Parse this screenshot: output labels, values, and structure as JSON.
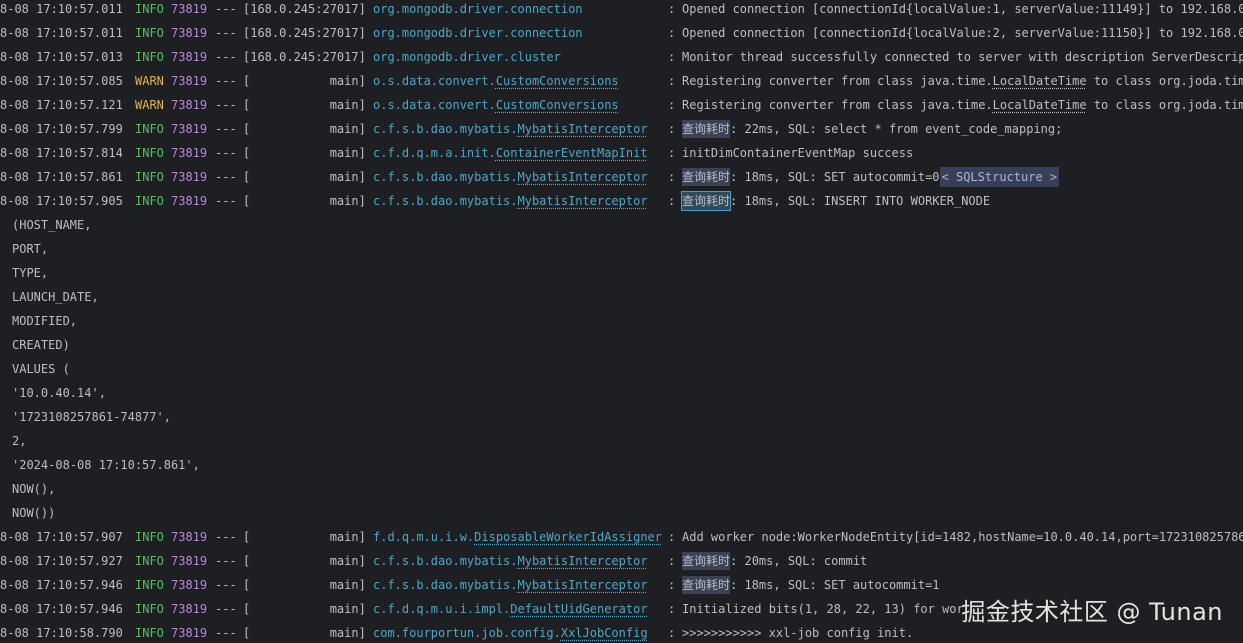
{
  "lines": [
    {
      "ts": "8-08 17:10:57.011",
      "level": "INFO",
      "pid": "73819",
      "dashes": "---",
      "thread": "[168.0.245:27017]",
      "logger_pre": "org.mongodb.driver.connection",
      "logger_cls": "",
      "colon": ":",
      "msg_hl": "",
      "msg": "Opened connection [connectionId{localValue:1, serverValue:11149}] to 192.168.0"
    },
    {
      "ts": "8-08 17:10:57.011",
      "level": "INFO",
      "pid": "73819",
      "dashes": "---",
      "thread": "[168.0.245:27017]",
      "logger_pre": "org.mongodb.driver.connection",
      "logger_cls": "",
      "colon": ":",
      "msg_hl": "",
      "msg": "Opened connection [connectionId{localValue:2, serverValue:11150}] to 192.168.0"
    },
    {
      "ts": "8-08 17:10:57.013",
      "level": "INFO",
      "pid": "73819",
      "dashes": "---",
      "thread": "[168.0.245:27017]",
      "logger_pre": "org.mongodb.driver.cluster",
      "logger_cls": "",
      "colon": ":",
      "msg_hl": "",
      "msg": "Monitor thread successfully connected to server with description ServerDescrip"
    },
    {
      "ts": "8-08 17:10:57.085",
      "level": "WARN",
      "pid": "73819",
      "dashes": "---",
      "thread": "[           main]",
      "logger_pre": "o.s.data.convert.",
      "logger_cls": "CustomConversions",
      "colon": ":",
      "msg_hl": "",
      "msg_pre": "Registering converter from class java.time.",
      "msg_ul": "LocalDateTime",
      "msg": " to class org.joda.tim"
    },
    {
      "ts": "8-08 17:10:57.121",
      "level": "WARN",
      "pid": "73819",
      "dashes": "---",
      "thread": "[           main]",
      "logger_pre": "o.s.data.convert.",
      "logger_cls": "CustomConversions",
      "colon": ":",
      "msg_hl": "",
      "msg_pre": "Registering converter from class java.time.",
      "msg_ul": "LocalDateTime",
      "msg": " to class org.joda.tim"
    },
    {
      "ts": "8-08 17:10:57.799",
      "level": "INFO",
      "pid": "73819",
      "dashes": "---",
      "thread": "[           main]",
      "logger_pre": "c.f.s.b.dao.mybatis.",
      "logger_cls": "MybatisInterceptor",
      "colon": ":",
      "msg_hl": "查询耗时",
      "msg": ": 22ms, SQL: select * from event_code_mapping;"
    },
    {
      "ts": "8-08 17:10:57.814",
      "level": "INFO",
      "pid": "73819",
      "dashes": "---",
      "thread": "[           main]",
      "logger_pre": "c.f.d.q.m.a.init.",
      "logger_cls": "ContainerEventMapInit",
      "colon": ":",
      "msg_hl": "",
      "msg": "initDimContainerEventMap success"
    },
    {
      "ts": "8-08 17:10:57.861",
      "level": "INFO",
      "pid": "73819",
      "dashes": "---",
      "thread": "[           main]",
      "logger_pre": "c.f.s.b.dao.mybatis.",
      "logger_cls": "MybatisInterceptor",
      "colon": ":",
      "msg_hl": "查询耗时",
      "msg": ": 18ms, SQL: SET autocommit=0",
      "msg_tag": "< SQLStructure >"
    },
    {
      "ts": "8-08 17:10:57.905",
      "level": "INFO",
      "pid": "73819",
      "dashes": "---",
      "thread": "[           main]",
      "logger_pre": "c.f.s.b.dao.mybatis.",
      "logger_cls": "MybatisInterceptor",
      "colon": ":",
      "msg_hl_box": "查询耗时",
      "msg": ": 18ms, SQL: INSERT INTO WORKER_NODE"
    },
    {
      "cont": "(HOST_NAME,"
    },
    {
      "cont": "PORT,"
    },
    {
      "cont": "TYPE,"
    },
    {
      "cont": "LAUNCH_DATE,"
    },
    {
      "cont": "MODIFIED,"
    },
    {
      "cont": "CREATED)"
    },
    {
      "cont": "VALUES ("
    },
    {
      "cont": "'10.0.40.14',"
    },
    {
      "cont": "'1723108257861-74877',"
    },
    {
      "cont": "2,"
    },
    {
      "cont": "'2024-08-08 17:10:57.861',"
    },
    {
      "cont": "NOW(),"
    },
    {
      "cont": "NOW())"
    },
    {
      "ts": "8-08 17:10:57.907",
      "level": "INFO",
      "pid": "73819",
      "dashes": "---",
      "thread": "[           main]",
      "logger_pre": "f.d.q.m.u.i.w.",
      "logger_cls": "DisposableWorkerIdAssigner",
      "colon": ":",
      "msg_hl": "",
      "msg": "Add worker node:WorkerNodeEntity[id=1482,hostName=10.0.40.14,port=172310825786"
    },
    {
      "ts": "8-08 17:10:57.927",
      "level": "INFO",
      "pid": "73819",
      "dashes": "---",
      "thread": "[           main]",
      "logger_pre": "c.f.s.b.dao.mybatis.",
      "logger_cls": "MybatisInterceptor",
      "colon": ":",
      "msg_hl": "查询耗时",
      "msg": ": 20ms, SQL: commit"
    },
    {
      "ts": "8-08 17:10:57.946",
      "level": "INFO",
      "pid": "73819",
      "dashes": "---",
      "thread": "[           main]",
      "logger_pre": "c.f.s.b.dao.mybatis.",
      "logger_cls": "MybatisInterceptor",
      "colon": ":",
      "msg_hl": "查询耗时",
      "msg": ": 18ms, SQL: SET autocommit=1"
    },
    {
      "ts": "8-08 17:10:57.946",
      "level": "INFO",
      "pid": "73819",
      "dashes": "---",
      "thread": "[           main]",
      "logger_pre": "c.f.d.q.m.u.i.impl.",
      "logger_cls": "DefaultUidGenerator",
      "colon": ":",
      "msg_hl": "",
      "msg": "Initialized bits(1, 28, 22, 13) for wor"
    },
    {
      "ts": "8-08 17:10:58.790",
      "level": "INFO",
      "pid": "73819",
      "dashes": "---",
      "thread": "[           main]",
      "logger_pre": "com.fourportun.job.config.",
      "logger_cls": "XxlJobConfig",
      "colon": ":",
      "msg_hl": "",
      "msg": ">>>>>>>>>>> xxl-job config init."
    }
  ],
  "watermark": "掘金技术社区 @ Tunan",
  "colors": {
    "background": "#1e1f22",
    "info": "#5fb865",
    "warn": "#e0b44c",
    "pid": "#b589d6",
    "logger": "#4fa7c4"
  }
}
